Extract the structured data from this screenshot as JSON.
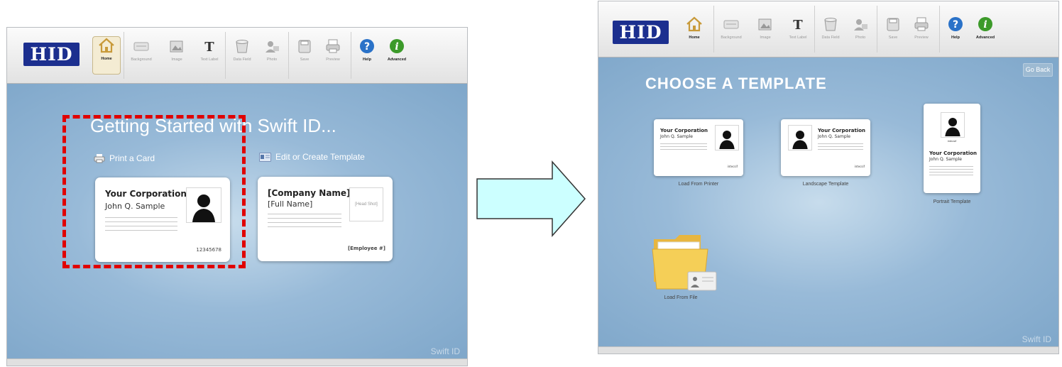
{
  "toolbar": {
    "logo": "HID",
    "items": [
      {
        "label": "Home",
        "icon": "home-icon"
      },
      {
        "label": "Background",
        "icon": "background-icon"
      },
      {
        "label": "Image",
        "icon": "image-icon"
      },
      {
        "label": "Text Label",
        "icon": "text-label-icon"
      },
      {
        "label": "Data Field",
        "icon": "data-field-icon"
      },
      {
        "label": "Photo",
        "icon": "photo-icon"
      },
      {
        "label": "Save",
        "icon": "save-icon"
      },
      {
        "label": "Preview",
        "icon": "preview-icon"
      },
      {
        "label": "Help",
        "icon": "help-icon"
      },
      {
        "label": "Advanced",
        "icon": "advanced-icon"
      }
    ]
  },
  "left": {
    "title": "Getting Started with Swift ID...",
    "print_label": "Print a Card",
    "template_label": "Edit or Create Template",
    "card1": {
      "corp": "Your Corporation",
      "name": "John Q. Sample",
      "number": "12345678"
    },
    "card2": {
      "corp": "[Company Name]",
      "name": "[Full Name]",
      "photo": "[Head Shot]",
      "number": "[Employee #]"
    },
    "watermark": "Swift ID"
  },
  "right": {
    "title": "CHOOSE A TEMPLATE",
    "go_back": "Go Back",
    "templates": [
      {
        "label": "Load From Printer",
        "corp": "Your Corporation",
        "name": "John Q. Sample",
        "sig": "intecsif"
      },
      {
        "label": "Landscape Template",
        "corp": "Your Corporation",
        "name": "John Q. Sample",
        "sig": "intecsif"
      },
      {
        "label": "Portrait Template",
        "corp": "Your Corporation",
        "name": "John Q. Sample",
        "sig": "intecsif"
      }
    ],
    "load_file": "Load From File",
    "watermark": "Swift ID"
  },
  "colors": {
    "accent": "#1c2f8f",
    "stage": "#8db1d2",
    "highlight": "#e00000",
    "arrow": "#ccffff"
  }
}
